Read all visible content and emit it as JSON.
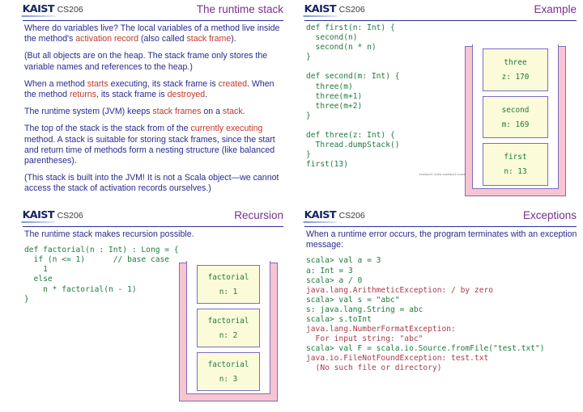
{
  "brand": {
    "logo_text": "KAIST",
    "course_code": "CS206"
  },
  "slides": [
    {
      "id": "runtime-stack",
      "title": "The runtime stack",
      "paragraphs": [
        [
          {
            "t": "Where do variables live?  The local variables of a method live inside the method's ",
            "hl": false
          },
          {
            "t": "activation record",
            "hl": true
          },
          {
            "t": " (also called ",
            "hl": false
          },
          {
            "t": "stack frame",
            "hl": true
          },
          {
            "t": ").",
            "hl": false
          }
        ],
        [
          {
            "t": "(But all objects are on the heap.  The stack frame only stores the variable names and references to the heap.)",
            "hl": false
          }
        ],
        [
          {
            "t": "When a method ",
            "hl": false
          },
          {
            "t": "starts",
            "hl": true
          },
          {
            "t": " executing, its stack frame is ",
            "hl": false
          },
          {
            "t": "created",
            "hl": true
          },
          {
            "t": ". When the method ",
            "hl": false
          },
          {
            "t": "returns",
            "hl": true
          },
          {
            "t": ", its stack frame is ",
            "hl": false
          },
          {
            "t": "destroyed",
            "hl": true
          },
          {
            "t": ".",
            "hl": false
          }
        ],
        [
          {
            "t": "The runtime system (JVM) keeps ",
            "hl": false
          },
          {
            "t": "stack frames",
            "hl": true
          },
          {
            "t": " on a ",
            "hl": false
          },
          {
            "t": "stack",
            "hl": true
          },
          {
            "t": ".",
            "hl": false
          }
        ],
        [
          {
            "t": "The top of the stack is the stack from of the ",
            "hl": false
          },
          {
            "t": "currently executing",
            "hl": true
          },
          {
            "t": " method.  A stack is suitable for storing stack frames, since the start and return time of methods form a nesting structure (like balanced parentheses).",
            "hl": false
          }
        ],
        [
          {
            "t": "(This stack is built into the JVM! It is not a Scala object—we cannot access the stack of activation records ourselves.)",
            "hl": false
          }
        ]
      ]
    },
    {
      "id": "example",
      "title": "Example",
      "code_lines": [
        {
          "t": "def first(n: Int) {",
          "err": false
        },
        {
          "t": "  second(n)",
          "err": false
        },
        {
          "t": "  second(n * n)",
          "err": false
        },
        {
          "t": "}",
          "err": false
        },
        {
          "t": "",
          "err": false
        },
        {
          "t": "def second(m: Int) {",
          "err": false
        },
        {
          "t": "  three(m)",
          "err": false
        },
        {
          "t": "  three(m+1)",
          "err": false
        },
        {
          "t": "  three(m+2)",
          "err": false
        },
        {
          "t": "}",
          "err": false
        },
        {
          "t": "",
          "err": false
        },
        {
          "t": "def three(z: Int) {",
          "err": false
        },
        {
          "t": "  Thread.dumpStack()",
          "err": false
        },
        {
          "t": "}",
          "err": false
        },
        {
          "t": "first(13)",
          "err": false
        }
      ],
      "caption": "example1.scala  example2.scala",
      "stack_frames": [
        {
          "name": "three",
          "var": "z: 170"
        },
        {
          "name": "second",
          "var": "m: 169"
        },
        {
          "name": "first",
          "var": "n: 13"
        }
      ]
    },
    {
      "id": "recursion",
      "title": "Recursion",
      "paragraphs": [
        [
          {
            "t": "The runtime stack makes recursion possible.",
            "hl": false
          }
        ]
      ],
      "code_lines": [
        {
          "t": "def factorial(n : Int) : Long = {",
          "err": false
        },
        {
          "t": "  if (n <= 1)      // base case",
          "err": false
        },
        {
          "t": "    1",
          "err": false
        },
        {
          "t": "  else",
          "err": false
        },
        {
          "t": "    n * factorial(n - 1)",
          "err": false
        },
        {
          "t": "}",
          "err": false
        }
      ],
      "stack_frames": [
        {
          "name": "factorial",
          "var": "n: 1"
        },
        {
          "name": "factorial",
          "var": "n: 2"
        },
        {
          "name": "factorial",
          "var": "n: 3"
        }
      ]
    },
    {
      "id": "exceptions",
      "title": "Exceptions",
      "paragraphs": [
        [
          {
            "t": "When a runtime error occurs, the program terminates with an exception message:",
            "hl": false
          }
        ]
      ],
      "code_lines": [
        {
          "t": "scala> val a = 3",
          "err": false
        },
        {
          "t": "a: Int = 3",
          "err": false
        },
        {
          "t": "scala> a / 0",
          "err": false
        },
        {
          "t": "java.lang.ArithmeticException: / by zero",
          "err": true
        },
        {
          "t": "scala> val s = \"abc\"",
          "err": false
        },
        {
          "t": "s: java.lang.String = abc",
          "err": false
        },
        {
          "t": "scala> s.toInt",
          "err": false
        },
        {
          "t": "java.lang.NumberFormatException:",
          "err": true
        },
        {
          "t": "  For input string: \"abc\"",
          "err": true
        },
        {
          "t": "scala> val F = scala.io.Source.fromFile(\"test.txt\")",
          "err": false
        },
        {
          "t": "java.io.FileNotFoundException: test.txt",
          "err": true
        },
        {
          "t": "  (No such file or directory)",
          "err": true
        }
      ]
    }
  ],
  "colors": {
    "title_purple": "#7a2f8f",
    "body_blue": "#282c8e",
    "highlight_red": "#c0392b",
    "code_green": "#1f7a3d",
    "exception_red": "#a63d4a",
    "rule_blue": "#2b2f9e",
    "stack_pink": "#f8c4d2",
    "frame_cream": "#fbfbda",
    "frame_border_purple": "#7b6fbe",
    "logo_navy": "#14245e"
  }
}
